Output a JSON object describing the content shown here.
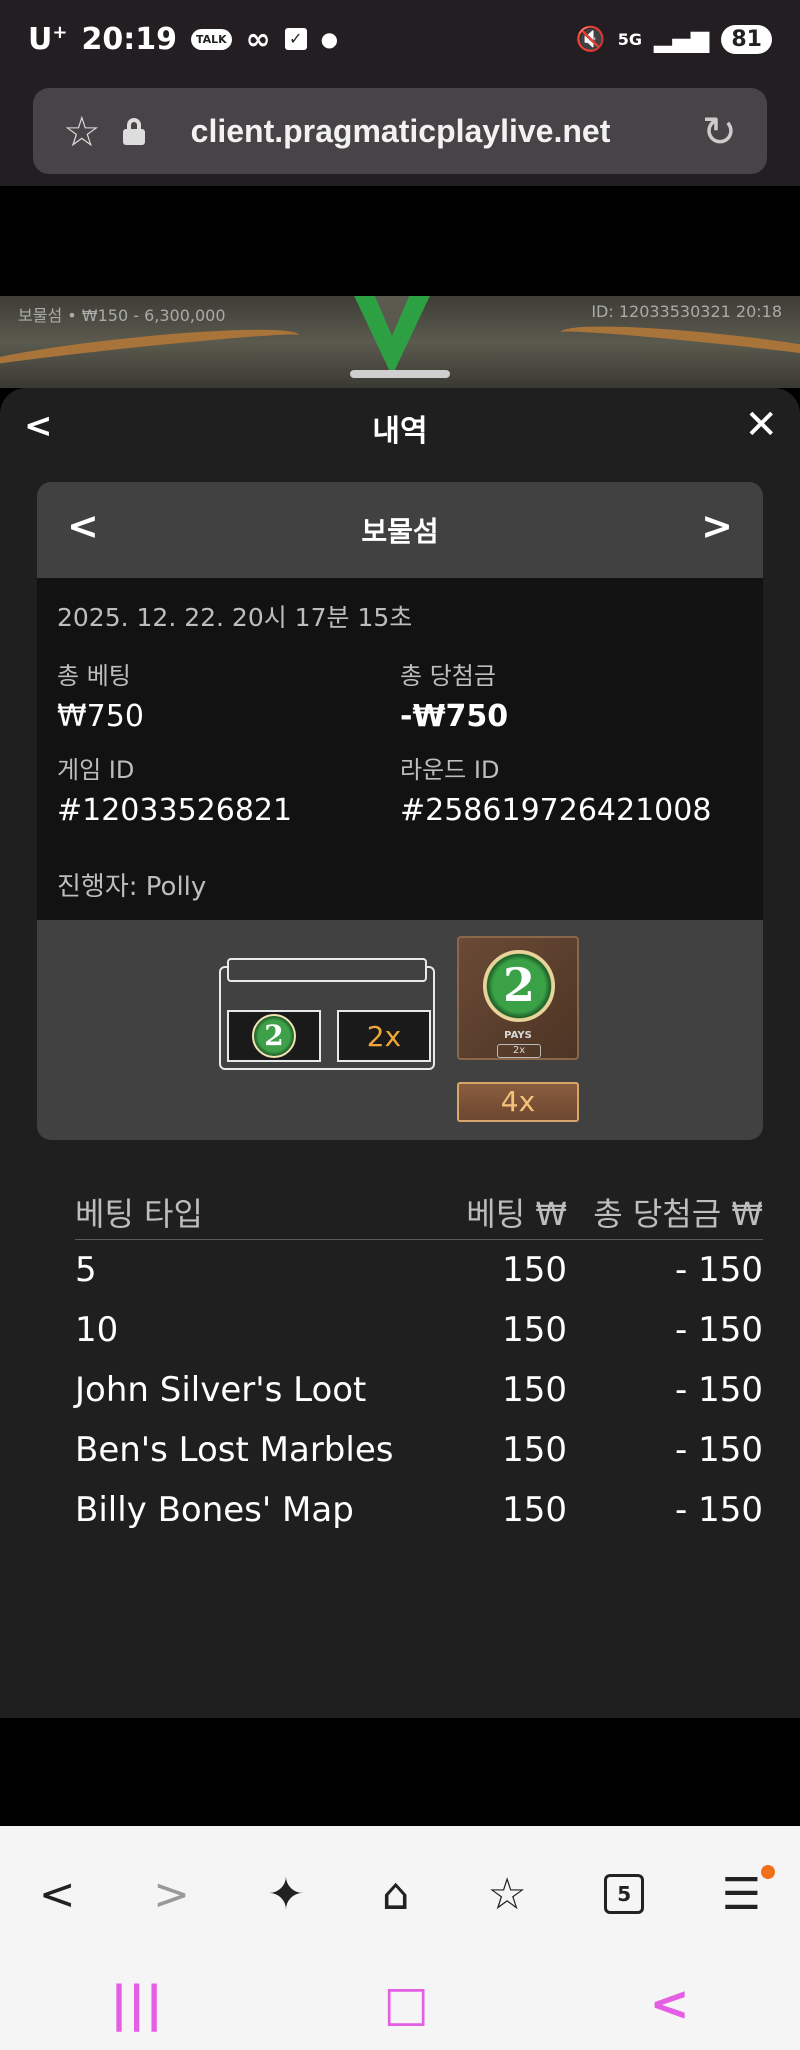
{
  "status_bar": {
    "carrier": "U",
    "carrier_sup": "+",
    "time": "20:19",
    "talk": "TALK",
    "battery": "81"
  },
  "browser": {
    "url": "client.pragmaticplaylive.net"
  },
  "game_strip": {
    "left_info": "보물섬 • ₩150 - 6,300,000",
    "right_info": "ID: 12033530321 20:18"
  },
  "sheet": {
    "title": "내역"
  },
  "card": {
    "title": "보물섬",
    "date": "2025. 12. 22. 20시 17분 15초",
    "total_bet_label": "총 베팅",
    "total_bet_value": "₩750",
    "total_win_label": "총 당첨금",
    "total_win_value": "-₩750",
    "game_id_label": "게임 ID",
    "game_id_value": "#12033526821",
    "round_id_label": "라운드 ID",
    "round_id_value": "#258619726421008",
    "host": "진행자: Polly",
    "result": {
      "slot1_number": "2",
      "slot2_multiplier": "2x",
      "tile_number": "2",
      "tile_pays": "PAYS",
      "tile_pays_x": "2x",
      "final_multiplier": "4x"
    }
  },
  "table": {
    "headers": [
      "베팅 타입",
      "베팅 ₩",
      "총 당첨금 ₩"
    ],
    "rows": [
      {
        "type": "5",
        "bet": "150",
        "win": "- 150"
      },
      {
        "type": "10",
        "bet": "150",
        "win": "- 150"
      },
      {
        "type": "John Silver's Loot",
        "bet": "150",
        "win": "- 150"
      },
      {
        "type": "Ben's Lost Marbles",
        "bet": "150",
        "win": "- 150"
      },
      {
        "type": "Billy Bones' Map",
        "bet": "150",
        "win": "- 150"
      }
    ]
  },
  "bottom_nav": {
    "tabs_count": "5"
  },
  "icons": {
    "accent": "#e45fe3",
    "notify": "#f2701b"
  }
}
